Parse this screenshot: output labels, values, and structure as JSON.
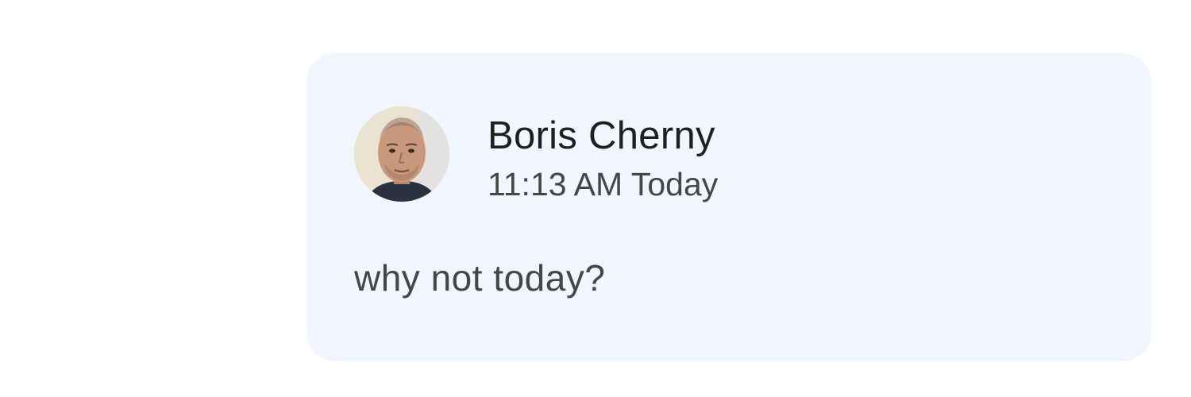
{
  "message": {
    "sender_name": "Boris Cherny",
    "timestamp": "11:13 AM Today",
    "text": "why not today?"
  },
  "colors": {
    "card_background": "#f1f5fd",
    "name_text": "#1f1f1f",
    "secondary_text": "#444746"
  },
  "icons": {
    "avatar": "user-photo-avatar"
  }
}
